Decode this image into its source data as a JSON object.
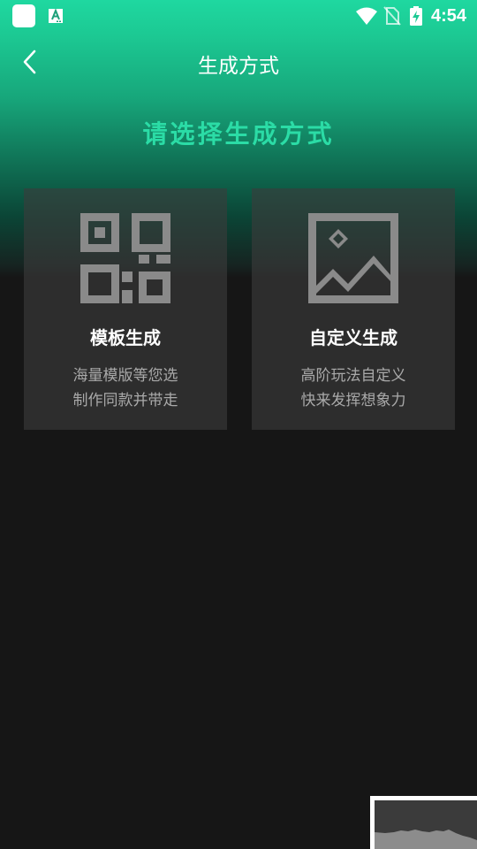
{
  "status_bar": {
    "time": "4:54",
    "icons": [
      "app-icon",
      "font-a-icon",
      "wifi-icon",
      "no-sim-icon",
      "battery-charging-icon"
    ]
  },
  "header": {
    "title": "生成方式",
    "back_icon": "back-icon"
  },
  "headline": "请选择生成方式",
  "cards": [
    {
      "icon": "qr-code-icon",
      "title": "模板生成",
      "desc_line1": "海量模版等您选",
      "desc_line2": "制作同款并带走"
    },
    {
      "icon": "image-icon",
      "title": "自定义生成",
      "desc_line1": "高阶玩法自定义",
      "desc_line2": "快来发挥想象力"
    }
  ],
  "floating_thumbnail": {
    "icon": "preview-thumbnail"
  },
  "colors": {
    "accent": "#2bdca6",
    "gradient_top": "#1fd8a0",
    "background": "#161616",
    "card_bg": "#3c3c3c",
    "icon_gray": "#8a8a8a",
    "desc_text": "#a9a9a9"
  }
}
